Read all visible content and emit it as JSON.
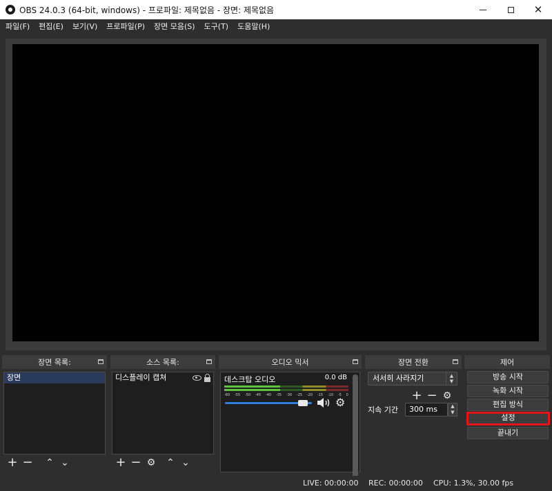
{
  "window": {
    "title": "OBS 24.0.3 (64-bit, windows) - 프로파일: 제목없음 - 장면: 제목없음",
    "minimize": "",
    "maximize": "",
    "close": "✕"
  },
  "menu": [
    "파일(F)",
    "편집(E)",
    "보기(V)",
    "프로파일(P)",
    "장면 모음(S)",
    "도구(T)",
    "도움말(H)"
  ],
  "scenes": {
    "title": "장면 목록:",
    "items": [
      "장면"
    ]
  },
  "sources": {
    "title": "소스 목록:",
    "items": [
      "디스플레이 캡쳐"
    ]
  },
  "mixer": {
    "title": "오디오 믹서",
    "channel": "데스크탑 오디오",
    "db": "0.0 dB",
    "ticks": [
      "-60",
      "-55",
      "-50",
      "-45",
      "-40",
      "-35",
      "-30",
      "-25",
      "-20",
      "-15",
      "-10",
      "-5",
      "0"
    ],
    "volume": 0.95
  },
  "transitions": {
    "title": "장면 전환",
    "selected": "서서히 사라지기",
    "duration_label": "지속 기간",
    "duration_value": "300 ms"
  },
  "controls": {
    "title": "제어",
    "buttons": [
      "방송 시작",
      "녹화 시작",
      "편집 방식",
      "설정",
      "끝내기"
    ]
  },
  "status": {
    "live": "LIVE: 00:00:00",
    "rec": "REC: 00:00:00",
    "cpu": "CPU: 1.3%, 30.00 fps"
  },
  "colors": {
    "highlight": "#e3151a",
    "accent": "#2d7fd8"
  }
}
